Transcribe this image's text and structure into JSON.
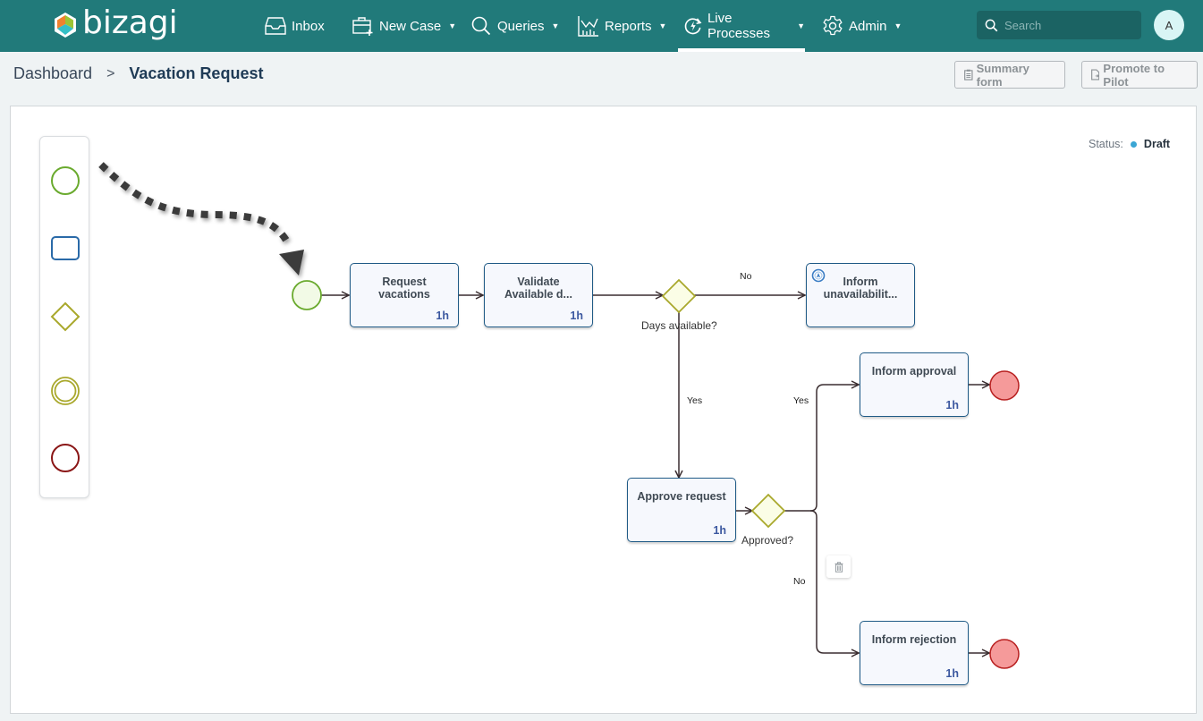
{
  "app": {
    "brand": "bizagi",
    "colors": {
      "topbar": "#217a7a",
      "active_tab_indicator": "#ffffff",
      "task_border": "#1f5a86",
      "start_event": "#6aaa2e",
      "gateway": "#a9a82c",
      "end_event_fill": "#f59a9a",
      "status_draft": "#3aa6d4"
    }
  },
  "nav": {
    "items": [
      {
        "label": "Inbox",
        "icon": "inbox-icon",
        "has_caret": false
      },
      {
        "label": "New Case",
        "icon": "briefcase-plus-icon",
        "has_caret": true
      },
      {
        "label": "Queries",
        "icon": "search-icon",
        "has_caret": true
      },
      {
        "label": "Reports",
        "icon": "chart-icon",
        "has_caret": true
      },
      {
        "label": "Live Processes",
        "icon": "lightning-refresh-icon",
        "has_caret": true,
        "active": true
      },
      {
        "label": "Admin",
        "icon": "gear-icon",
        "has_caret": true
      }
    ],
    "caret": "▼",
    "search_placeholder": "Search",
    "avatar_initial": "A"
  },
  "breadcrumb": {
    "parent": "Dashboard",
    "separator": ">",
    "current": "Vacation Request"
  },
  "actions": {
    "summary_form": "Summary form",
    "promote_to_pilot": "Promote to Pilot"
  },
  "status": {
    "label": "Status:",
    "value": "Draft"
  },
  "palette": {
    "items": [
      "start-event",
      "task",
      "gateway",
      "intermediate-event",
      "end-event"
    ]
  },
  "diagram": {
    "tasks": [
      {
        "id": "request-vacations",
        "label": "Request vacations",
        "duration": "1h"
      },
      {
        "id": "validate-available-days",
        "label": "Validate Available d...",
        "duration": "1h"
      },
      {
        "id": "inform-unavailability",
        "label": "Inform unavailabilit...",
        "duration": "",
        "icon": "script-icon"
      },
      {
        "id": "inform-approval",
        "label": "Inform approval",
        "duration": "1h"
      },
      {
        "id": "approve-request",
        "label": "Approve request",
        "duration": "1h"
      },
      {
        "id": "inform-rejection",
        "label": "Inform rejection",
        "duration": "1h"
      }
    ],
    "gateways": [
      {
        "id": "days-available",
        "label": "Days available?"
      },
      {
        "id": "approved",
        "label": "Approved?"
      }
    ],
    "flow_labels": {
      "days_no": "No",
      "days_yes": "Yes",
      "approved_yes": "Yes",
      "approved_no": "No"
    }
  }
}
